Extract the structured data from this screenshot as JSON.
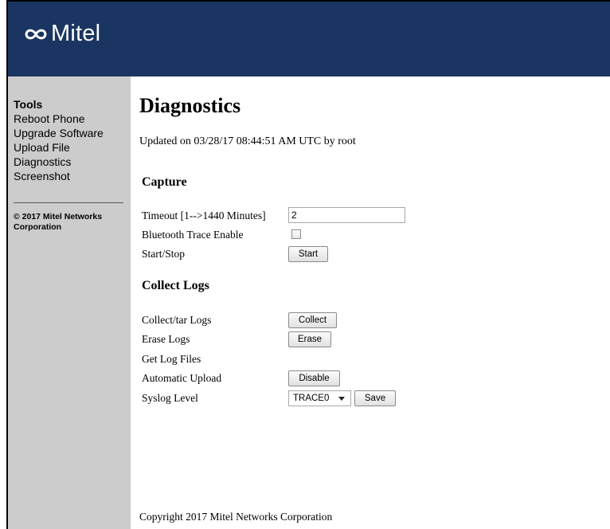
{
  "header": {
    "brand": "Mitel",
    "logo_icon": "mitel-infinity-logo",
    "background": "#1a3561"
  },
  "sidebar": {
    "title": "Tools",
    "items": [
      {
        "label": "Reboot Phone"
      },
      {
        "label": "Upgrade Software"
      },
      {
        "label": "Upload File"
      },
      {
        "label": "Diagnostics"
      },
      {
        "label": "Screenshot"
      }
    ],
    "copyright": "© 2017 Mitel Networks Corporation",
    "background": "#cccccc"
  },
  "main": {
    "title": "Diagnostics",
    "updated": "Updated on 03/28/17 08:44:51 AM UTC by root",
    "capture": {
      "heading": "Capture",
      "timeout_label": "Timeout [1-->1440 Minutes]",
      "timeout_value": "2",
      "bt_label": "Bluetooth Trace Enable",
      "bt_checked": false,
      "startstop_label": "Start/Stop",
      "start_button": "Start"
    },
    "logs": {
      "heading": "Collect Logs",
      "collect_label": "Collect/tar Logs",
      "collect_button": "Collect",
      "erase_label": "Erase Logs",
      "erase_button": "Erase",
      "get_label": "Get Log Files",
      "auto_label": "Automatic Upload",
      "auto_button": "Disable",
      "syslog_label": "Syslog Level",
      "syslog_value": "TRACE0",
      "save_button": "Save"
    },
    "footer": "Copyright 2017 Mitel Networks Corporation"
  }
}
